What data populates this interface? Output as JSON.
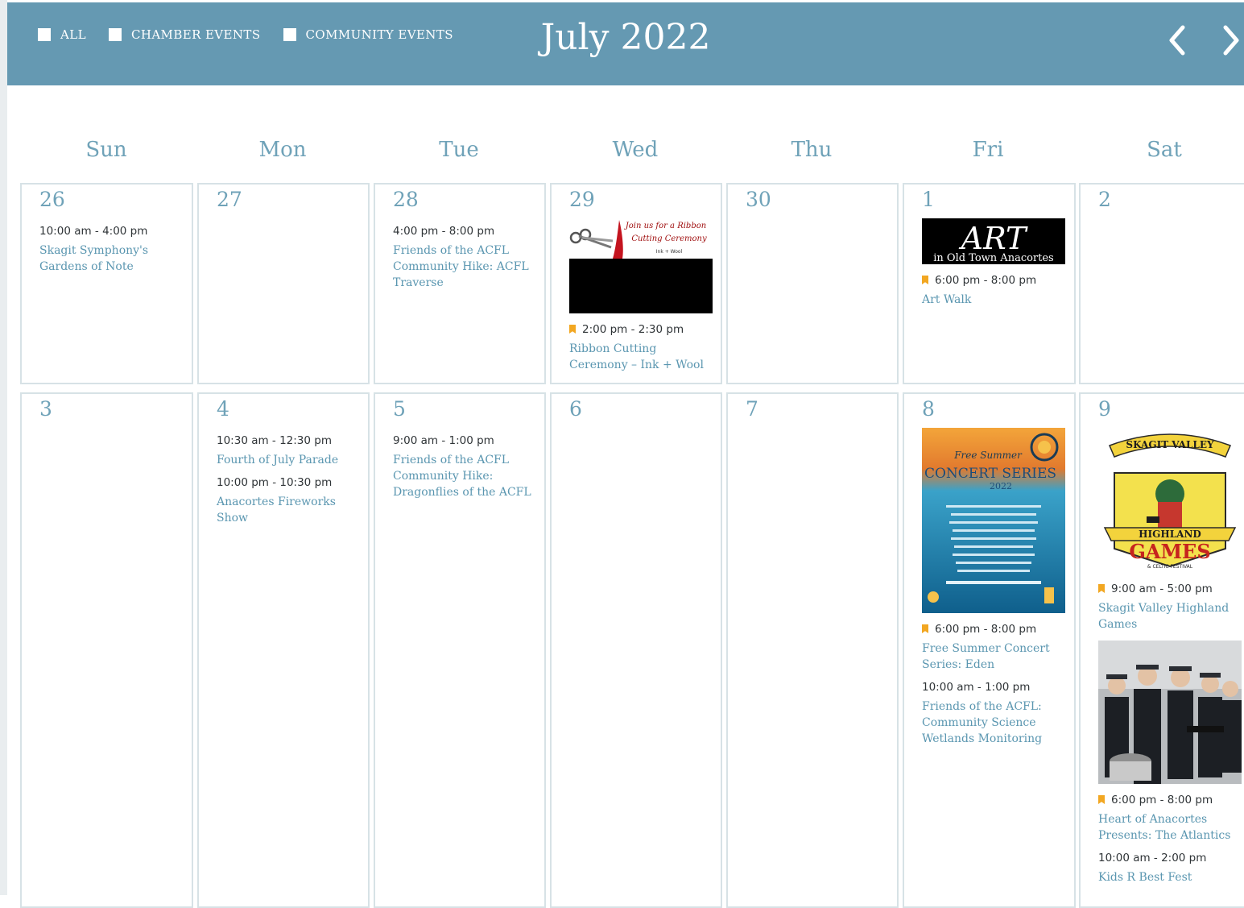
{
  "header": {
    "filters": [
      {
        "label": "ALL"
      },
      {
        "label": "CHAMBER EVENTS"
      },
      {
        "label": "COMMUNITY EVENTS"
      }
    ],
    "month_title": "July 2022",
    "prev_icon": "chevron-left-icon",
    "next_icon": "chevron-right-icon"
  },
  "weekdays": [
    "Sun",
    "Mon",
    "Tue",
    "Wed",
    "Thu",
    "Fri",
    "Sat"
  ],
  "weeks": [
    {
      "days": [
        {
          "day": "26",
          "events": [
            {
              "time": "10:00 am - 4:00 pm",
              "title": "Skagit Symphony's Gardens of Note"
            }
          ]
        },
        {
          "day": "27",
          "events": []
        },
        {
          "day": "28",
          "events": [
            {
              "time": "4:00 pm - 8:00 pm",
              "title": "Friends of the ACFL Community Hike: ACFL Traverse"
            }
          ]
        },
        {
          "day": "29",
          "image": {
            "caption_line1": "Join us for a Ribbon",
            "caption_line2": "Cutting Ceremony",
            "caption_line3": "Ink + Wool"
          },
          "events": [
            {
              "time": "2:00 pm - 2:30 pm",
              "title": "Ribbon Cutting Ceremony – Ink + Wool",
              "chamber": true
            }
          ]
        },
        {
          "day": "30",
          "events": []
        },
        {
          "day": "1",
          "image": {
            "logo": "ART",
            "sub": "in Old Town Anacortes"
          },
          "events": [
            {
              "time": "6:00 pm - 8:00 pm",
              "title": "Art Walk",
              "chamber": true
            }
          ]
        },
        {
          "day": "2",
          "events": []
        }
      ]
    },
    {
      "days": [
        {
          "day": "3",
          "events": []
        },
        {
          "day": "4",
          "events": [
            {
              "time": "10:30 am - 12:30 pm",
              "title": "Fourth of July Parade"
            },
            {
              "time": "10:00 pm - 10:30 pm",
              "title": "Anacortes Fireworks Show"
            }
          ]
        },
        {
          "day": "5",
          "events": [
            {
              "time": "9:00 am - 1:00 pm",
              "title": "Friends of the ACFL Community Hike: Dragonflies of the ACFL"
            }
          ]
        },
        {
          "day": "6",
          "events": []
        },
        {
          "day": "7",
          "events": []
        },
        {
          "day": "8",
          "image": {
            "line1": "Free Summer",
            "line2": "CONCERT SERIES",
            "line3": "2022"
          },
          "events": [
            {
              "time": "6:00 pm - 8:00 pm",
              "title": "Free Summer Concert Series: Eden",
              "chamber": true
            },
            {
              "time": "10:00 am - 1:00 pm",
              "title": "Friends of the ACFL: Community Science Wetlands Monitoring"
            }
          ]
        },
        {
          "day": "9",
          "image": {
            "top": "SKAGIT VALLEY",
            "mid": "HIGHLAND",
            "big": "GAMES",
            "sub": "& CELTIC FESTIVAL"
          },
          "events": [
            {
              "time": "9:00 am - 5:00 pm",
              "title": "Skagit Valley Highland Games",
              "chamber": true
            },
            {
              "time": "6:00 pm - 8:00 pm",
              "title": "Heart of Anacortes Presents: The Atlantics",
              "chamber": true
            },
            {
              "time": "10:00 am - 2:00 pm",
              "title": "Kids R Best Fest"
            }
          ]
        }
      ]
    }
  ],
  "colors": {
    "header_bg": "#6599b2",
    "accent_text": "#6fa2b8",
    "link": "#5a96b0",
    "chamber_flag": "#f2a722",
    "cell_border": "#d7e2e6"
  }
}
